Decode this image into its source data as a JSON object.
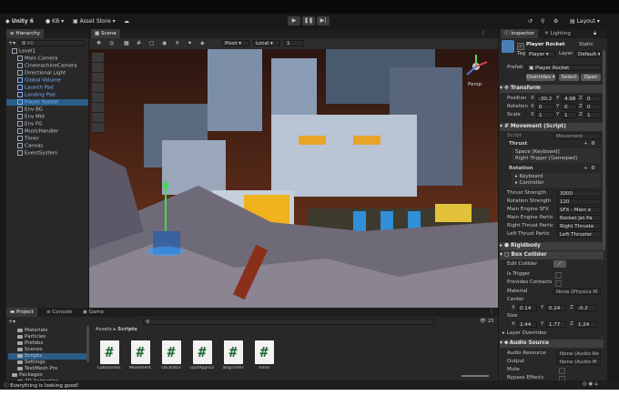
{
  "topbar": {
    "unity_label": "Unity 6",
    "account_label": "KB",
    "asset_store_label": "Asset Store",
    "layout_label": "Layout"
  },
  "hierarchy": {
    "tab": "Hierarchy",
    "search_placeholder": "All",
    "items": [
      {
        "label": "Level1",
        "blue": false,
        "selected": false,
        "indent": 1
      },
      {
        "label": "Main Camera",
        "blue": false,
        "selected": false,
        "indent": 2
      },
      {
        "label": "CinemachineCamera",
        "blue": false,
        "selected": false,
        "indent": 2
      },
      {
        "label": "Directional Light",
        "blue": false,
        "selected": false,
        "indent": 2
      },
      {
        "label": "Global Volume",
        "blue": true,
        "selected": false,
        "indent": 2
      },
      {
        "label": "Launch Pad",
        "blue": true,
        "selected": false,
        "indent": 2
      },
      {
        "label": "Landing Pad",
        "blue": true,
        "selected": false,
        "indent": 2
      },
      {
        "label": "Player Rocket",
        "blue": true,
        "selected": true,
        "indent": 2
      },
      {
        "label": "Env BG",
        "blue": false,
        "selected": false,
        "indent": 2
      },
      {
        "label": "Env Mid",
        "blue": false,
        "selected": false,
        "indent": 2
      },
      {
        "label": "Env FG",
        "blue": false,
        "selected": false,
        "indent": 2
      },
      {
        "label": "MusicHandler",
        "blue": false,
        "selected": false,
        "indent": 2
      },
      {
        "label": "Timer",
        "blue": false,
        "selected": false,
        "indent": 2
      },
      {
        "label": "Canvas",
        "blue": false,
        "selected": false,
        "indent": 2
      },
      {
        "label": "EventSystem",
        "blue": false,
        "selected": false,
        "indent": 2
      }
    ]
  },
  "scene": {
    "tab": "Scene",
    "pivot_label": "Pivot",
    "local_label": "Local",
    "grid_value": "1",
    "persp_label": "Persp"
  },
  "project": {
    "tabs": [
      "Project",
      "Console",
      "Game"
    ],
    "breadcrumb_root": "Assets",
    "breadcrumb_current": "Scripts",
    "count": "25",
    "folders": [
      {
        "label": "Materials",
        "selected": false,
        "indent": 1
      },
      {
        "label": "Particles",
        "selected": false,
        "indent": 1
      },
      {
        "label": "Prefabs",
        "selected": false,
        "indent": 1
      },
      {
        "label": "Scenes",
        "selected": false,
        "indent": 1
      },
      {
        "label": "Scripts",
        "selected": true,
        "indent": 1
      },
      {
        "label": "Settings",
        "selected": false,
        "indent": 1
      },
      {
        "label": "TextMesh Pro",
        "selected": false,
        "indent": 1
      },
      {
        "label": "Packages",
        "selected": false,
        "indent": 0
      },
      {
        "label": "2D Animation",
        "selected": false,
        "indent": 1
      }
    ],
    "scripts": [
      {
        "name": "CollisionHa..."
      },
      {
        "name": "Movement"
      },
      {
        "name": "Oscillator"
      },
      {
        "name": "QuitApplica..."
      },
      {
        "name": "StopTimer"
      },
      {
        "name": "Timer"
      }
    ]
  },
  "status": {
    "message": "Everything is looking good!"
  },
  "inspector": {
    "tabs": [
      "Inspector",
      "Lighting"
    ],
    "object_name": "Player Rocket",
    "static_label": "Static",
    "tag_label": "Tag",
    "tag_value": "Player",
    "layer_label": "Layer",
    "layer_value": "Default",
    "prefab_label": "Prefab",
    "prefab_value": "Player Rocket",
    "overrides_label": "Overrides",
    "select_label": "Select",
    "open_label": "Open",
    "transform": {
      "title": "Transform",
      "position_label": "Position",
      "position": {
        "x": "-30.2",
        "y": "4.98",
        "z": "0"
      },
      "rotation_label": "Rotation",
      "rotation": {
        "x": "0",
        "y": "0",
        "z": "0"
      },
      "scale_label": "Scale",
      "scale": {
        "x": "1",
        "y": "1",
        "z": "1"
      }
    },
    "movement": {
      "title": "Movement (Script)",
      "script_label": "Script",
      "script_value": "Movement",
      "thrust_label": "Thrust",
      "thrust_bindings": [
        "Space [Keyboard]",
        "Right Trigger [Gamepad]"
      ],
      "rotation_label": "Rotation",
      "rotation_bindings": [
        "Keyboard",
        "Controller"
      ],
      "fields": [
        {
          "label": "Thrust Strength",
          "value": "3000"
        },
        {
          "label": "Rotation Strength",
          "value": "120"
        },
        {
          "label": "Main Engine SFX",
          "value": "SFX - Main e"
        },
        {
          "label": "Main Engine Partic",
          "value": "Rocket Jet Pa"
        },
        {
          "label": "Right Thrust Partic",
          "value": "Right Thruste"
        },
        {
          "label": "Left Thrust Partic",
          "value": "Left Thruster"
        }
      ]
    },
    "rigidbody": {
      "title": "Rigidbody"
    },
    "box_collider": {
      "title": "Box Collider",
      "edit_collider_label": "Edit Collider",
      "is_trigger_label": "Is Trigger",
      "provides_contacts_label": "Provides Contacts",
      "material_label": "Material",
      "material_value": "None (Physics M",
      "center_label": "Center",
      "center": {
        "x": "0.14",
        "y": "0.24",
        "z": "-0.2"
      },
      "size_label": "Size",
      "size": {
        "x": "2.44",
        "y": "1.77",
        "z": "1.24"
      },
      "layer_overrides_label": "Layer Overrides"
    },
    "audio_source": {
      "title": "Audio Source",
      "fields": [
        {
          "label": "Audio Resource",
          "value": "None (Audio Re"
        },
        {
          "label": "Output",
          "value": "None (Audio M"
        },
        {
          "label": "Mute",
          "value": ""
        },
        {
          "label": "Bypass Effects",
          "value": ""
        }
      ]
    }
  },
  "colors": {
    "accent": "#2c5d87",
    "prefab_blue": "#7fb2ff",
    "panel": "#282828"
  }
}
